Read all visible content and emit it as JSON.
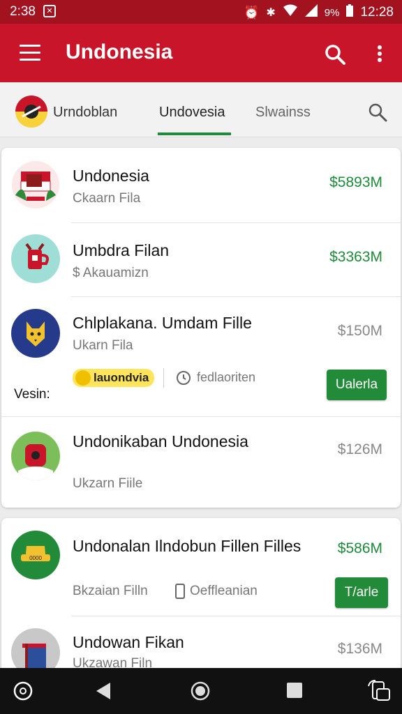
{
  "status_bar": {
    "time_left": "2:38",
    "battery_percent": "9%",
    "time_right": "12:28"
  },
  "app_bar": {
    "title": "Undonesia"
  },
  "tabs": [
    {
      "label": "Urndoblan"
    },
    {
      "label": "Undovesia",
      "selected": true
    },
    {
      "label": "Slwainss"
    }
  ],
  "list": [
    {
      "name": "Undonesia",
      "sub": "Ckaarn Fila",
      "price": "$5893M",
      "price_color": "#1f8a3a"
    },
    {
      "name": "Umbdra Filan",
      "sub": "$ Akauamizn",
      "price": "$3363M",
      "price_color": "#1f8a3a"
    },
    {
      "name": "Chlplakana. Umdam Fille",
      "sub": "Ukarn Fila",
      "price": "$150M",
      "price_color": "#888888",
      "tag": "lauondvia",
      "meta": "fedlaoriten",
      "left_label": "Vesin:",
      "button": "Ualerla"
    },
    {
      "name": "Undonikaban Undonesia",
      "sub": "Ukzarn Fiile",
      "price": "$126M",
      "price_color": "#888888"
    }
  ],
  "list2": [
    {
      "name": "Undonalan Ilndobun Fillen Filles",
      "sub": "Bkzaian Filln",
      "meta": "Oeffleanian",
      "price": "$586M",
      "price_color": "#1f8a3a",
      "button": "T/arle"
    },
    {
      "name": "Undowan Fikan",
      "sub": "Ukzawan Filn",
      "price": "$136M",
      "price_color": "#888888"
    }
  ],
  "colors": {
    "status_bar": "#a3121f",
    "app_bar": "#c9152a",
    "accent_green": "#1f8a3a"
  }
}
